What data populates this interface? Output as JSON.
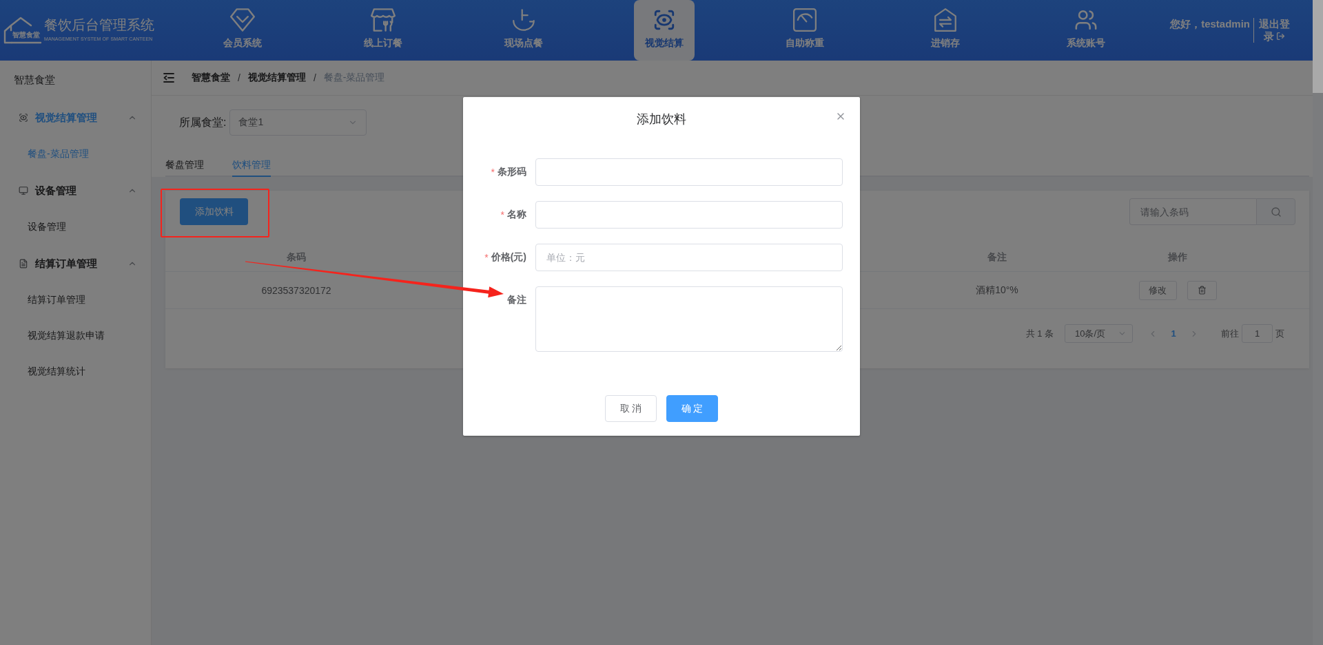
{
  "header": {
    "logo_badge": "智慧食堂",
    "title": "餐饮后台管理系统",
    "subtitle": "MANAGEMENT SYSTEM OF SMART CANTEEN",
    "nav": [
      {
        "label": "会员系统",
        "selected": false
      },
      {
        "label": "线上订餐",
        "selected": false
      },
      {
        "label": "现场点餐",
        "selected": false
      },
      {
        "label": "视觉结算",
        "selected": true
      },
      {
        "label": "自助称重",
        "selected": false
      },
      {
        "label": "进销存",
        "selected": false
      },
      {
        "label": "系统账号",
        "selected": false
      }
    ],
    "greeting": "您好，testadmin",
    "logout": "退出登录"
  },
  "sidebar": {
    "title": "智慧食堂",
    "groups": [
      {
        "label": "视觉结算管理",
        "expanded": true,
        "children": [
          {
            "label": "餐盘-菜品管理",
            "selected": true
          }
        ]
      },
      {
        "label": "设备管理",
        "expanded": true,
        "children": [
          {
            "label": "设备管理",
            "selected": false
          }
        ]
      },
      {
        "label": "结算订单管理",
        "expanded": true,
        "children": [
          {
            "label": "结算订单管理",
            "selected": false
          },
          {
            "label": "视觉结算退款申请",
            "selected": false
          },
          {
            "label": "视觉结算统计",
            "selected": false
          }
        ]
      }
    ]
  },
  "breadcrumbs": {
    "separator": "/",
    "items": [
      "智慧食堂",
      "视觉结算管理",
      "餐盘-菜品管理"
    ]
  },
  "filter": {
    "label": "所属食堂:",
    "value": "食堂1"
  },
  "tabs": [
    {
      "label": "餐盘管理",
      "selected": false
    },
    {
      "label": "饮料管理",
      "selected": true
    }
  ],
  "toolbar": {
    "add_button": "添加饮料",
    "search": {
      "placeholder": "请输入条码"
    }
  },
  "table": {
    "columns": [
      "条码",
      "备注",
      "操作"
    ],
    "rows": [
      {
        "cells": [
          "6923537320172",
          "酒精10°%"
        ],
        "actions": [
          {
            "kind": "edit",
            "label": "修改"
          },
          {
            "kind": "delete"
          }
        ]
      }
    ]
  },
  "pagination": {
    "total": "共 1 条",
    "page_size": "10条/页",
    "pages": [
      {
        "label": "1",
        "selected": true
      }
    ],
    "goto_label": "前往",
    "goto_value": "1",
    "goto_suffix": "页"
  },
  "dialog": {
    "title": "添加饮料",
    "fields": [
      {
        "kind": "input",
        "label": "条形码",
        "required_mark": "*"
      },
      {
        "kind": "input",
        "label": "名称",
        "required_mark": "*"
      },
      {
        "kind": "input",
        "label": "价格(元)",
        "required_mark": "*",
        "placeholder": "单位：元"
      },
      {
        "kind": "textarea",
        "label": "备注"
      }
    ],
    "buttons": [
      {
        "kind": "default",
        "label": "取 消"
      },
      {
        "kind": "primary",
        "label": "确 定"
      }
    ]
  },
  "annotations": {
    "highlight_frame": true,
    "arrow": true
  }
}
